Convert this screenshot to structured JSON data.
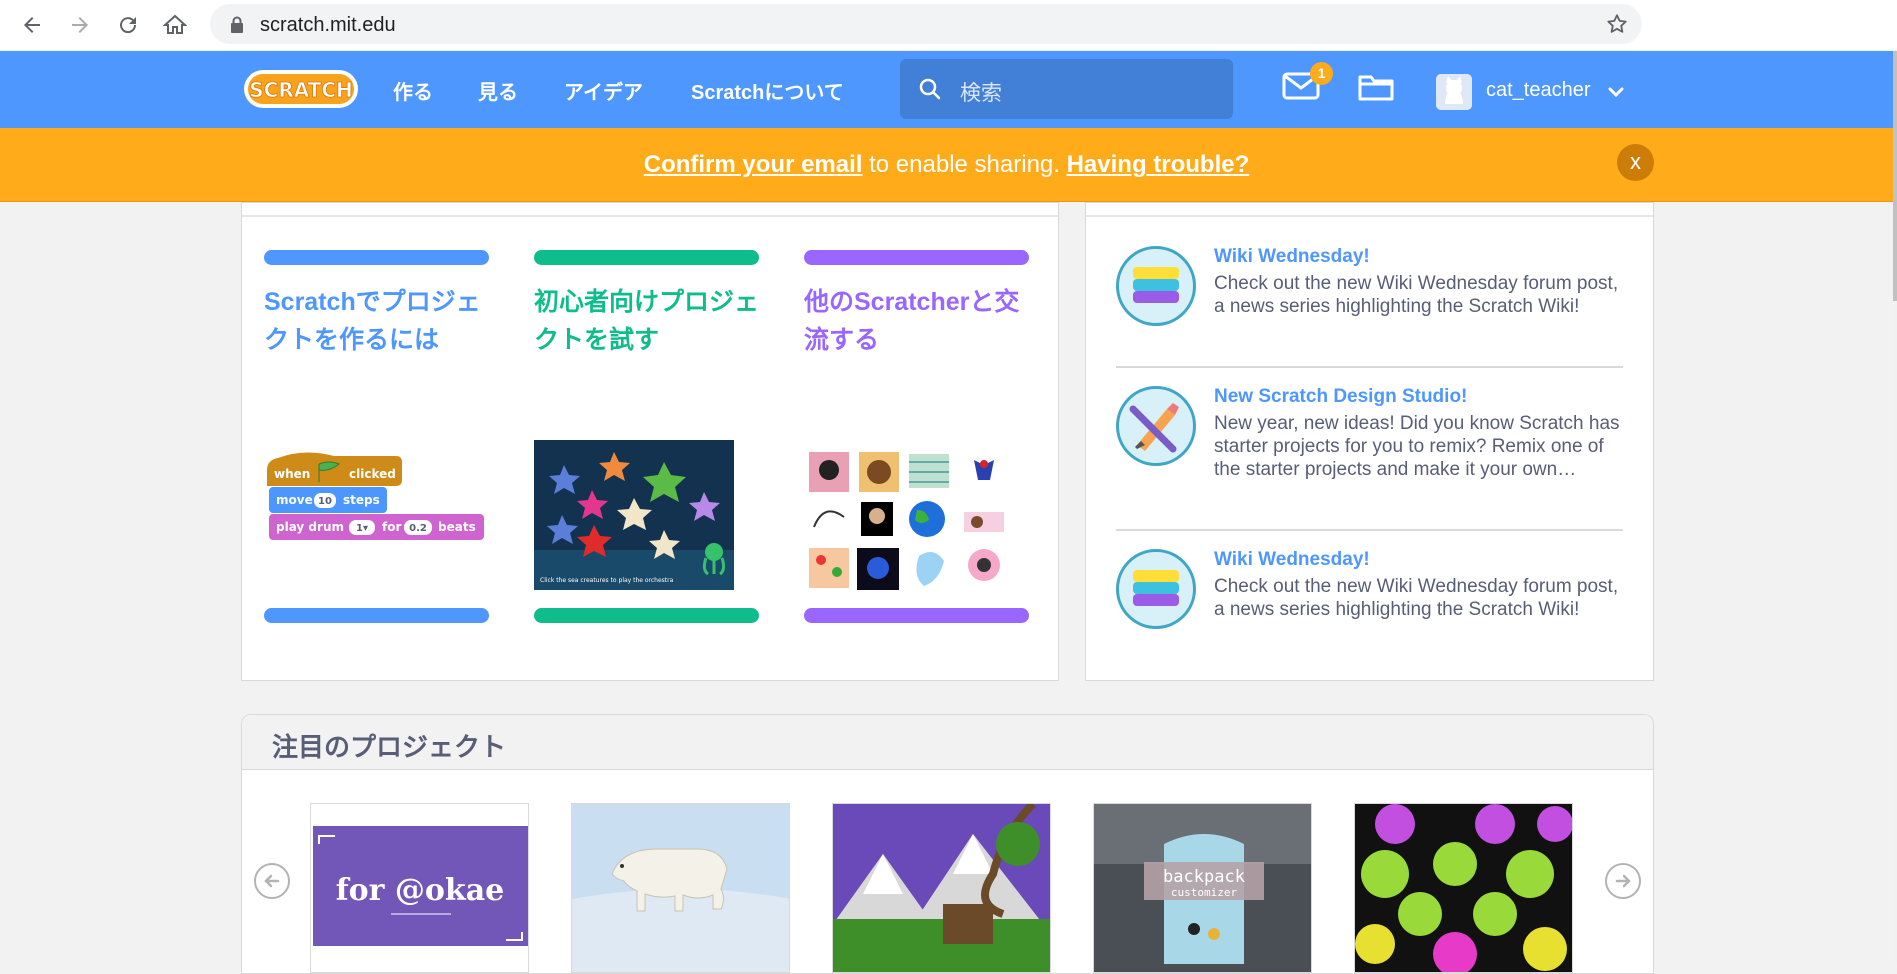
{
  "browser": {
    "url": "scratch.mit.edu",
    "icons": [
      "back-arrow-icon",
      "forward-arrow-icon",
      "reload-icon",
      "home-icon",
      "lock-icon",
      "star-icon"
    ]
  },
  "nav": {
    "logo_text": "SCRATCH",
    "links": [
      "作る",
      "見る",
      "アイデア",
      "Scratchについて"
    ],
    "search_placeholder": "検索",
    "message_count": "1",
    "username": "cat_teacher",
    "accent_color": "#4d97ff"
  },
  "banner": {
    "confirm_link": "Confirm your email",
    "middle_text": " to enable sharing. ",
    "trouble_link": "Having trouble?",
    "close_label": "x",
    "color": "#ffab1a"
  },
  "intro": {
    "columns": [
      {
        "title": "Scratchでプロジェクトを作るには",
        "color": "#4d97ff"
      },
      {
        "title": "初心者向けプロジェクトを試す",
        "color": "#0fbd8c"
      },
      {
        "title": "他のScratcherと交流する",
        "color": "#9966ff"
      }
    ],
    "blocks": {
      "when": "when",
      "clicked": "clicked",
      "move": "move",
      "steps_value": "10",
      "steps": "steps",
      "play_drum": "play drum",
      "drum_value": "1▾",
      "for": "for",
      "beats_value": "0.2",
      "beats": "beats"
    },
    "starter_caption": "Click the sea creatures to play the orchestra"
  },
  "news": {
    "items": [
      {
        "title": "Wiki Wednesday!",
        "body": "Check out the new Wiki Wednesday forum post, a news series highlighting the Scratch Wiki!"
      },
      {
        "title": "New Scratch Design Studio!",
        "body": "New year, new ideas! Did you know Scratch has starter projects for you to remix? Remix one of the starter projects and make it your own…"
      },
      {
        "title": "Wiki Wednesday!",
        "body": "Check out the new Wiki Wednesday forum post, a news series highlighting the Scratch Wiki!"
      }
    ]
  },
  "featured": {
    "title": "注目のプロジェクト",
    "projects": [
      {
        "thumb_text": "for @okae"
      },
      {
        "thumb_text": ""
      },
      {
        "thumb_text": ""
      },
      {
        "thumb_text": "backpack",
        "thumb_sub": "customizer"
      },
      {
        "thumb_text": ""
      }
    ]
  }
}
